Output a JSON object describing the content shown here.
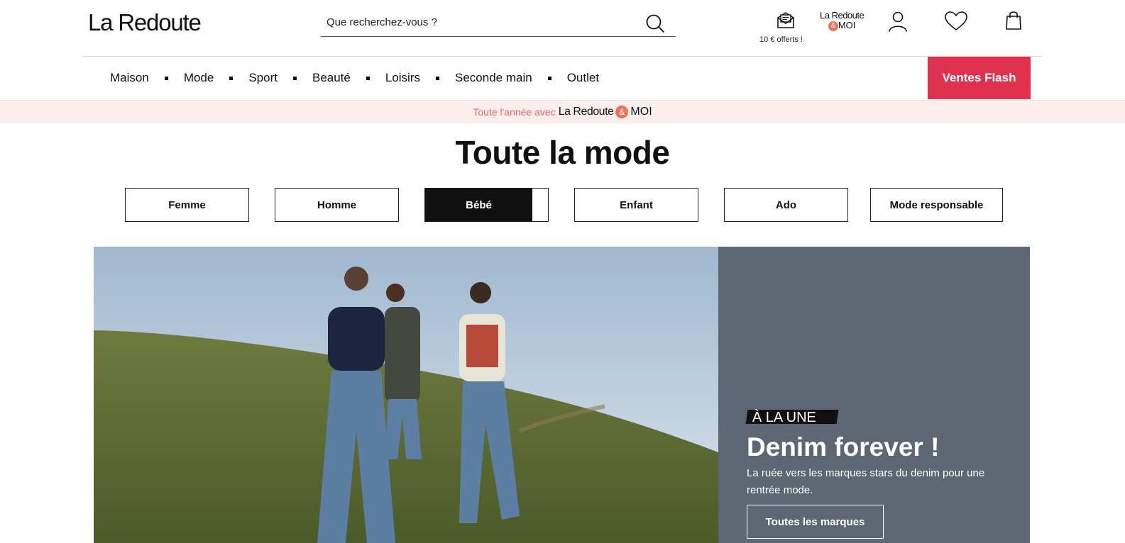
{
  "header": {
    "logo": "La Redoute",
    "search_placeholder": "Que recherchez-vous ?",
    "offer_label": "10 € offerts !",
    "moi_logo_line1": "La Redoute",
    "moi_logo_amp": "&",
    "moi_logo_line2": "MOI"
  },
  "nav": {
    "items": [
      "Maison",
      "Mode",
      "Sport",
      "Beauté",
      "Loisirs",
      "Seconde main",
      "Outlet"
    ],
    "flash_label": "Ventes Flash"
  },
  "promo": {
    "text": "Toute l'année avec",
    "brand": "La Redoute",
    "amp": "&",
    "moi": "MOI"
  },
  "page": {
    "title": "Toute la mode"
  },
  "categories": [
    {
      "label": "Femme",
      "active": false
    },
    {
      "label": "Homme",
      "active": false
    },
    {
      "label": "Bébé",
      "active": true
    },
    {
      "label": "Enfant",
      "active": false
    },
    {
      "label": "Ado",
      "active": false
    },
    {
      "label": "Mode responsable",
      "active": false
    }
  ],
  "hero": {
    "tag": "À LA UNE",
    "title": "Denim forever !",
    "description": "La ruée vers les marques stars du denim pour une rentrée mode.",
    "cta": "Toutes les marques"
  },
  "colors": {
    "flash": "#e0324f",
    "promo_bg": "#fdeeee",
    "promo_text": "#e56b5b",
    "hero_panel": "#5d6673",
    "accent_moi": "#e8735a"
  },
  "icons": [
    "search-icon",
    "offers-envelope-icon",
    "account-icon",
    "wishlist-heart-icon",
    "cart-bag-icon"
  ]
}
